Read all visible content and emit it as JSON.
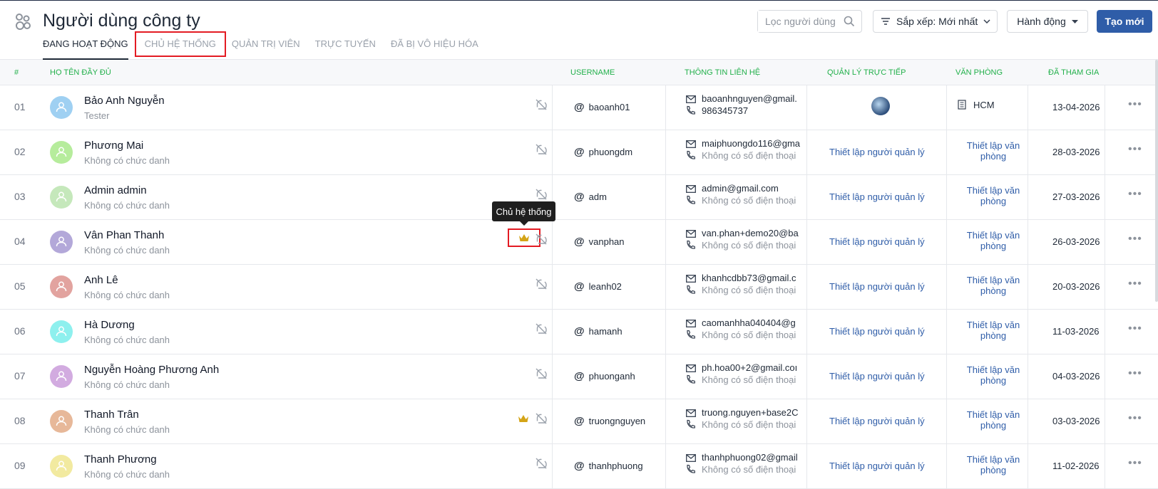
{
  "header": {
    "title": "Người dùng công ty",
    "tabs": [
      {
        "label": "ĐANG HOẠT ĐỘNG"
      },
      {
        "label": "CHỦ HỆ THỐNG"
      },
      {
        "label": "QUẢN TRỊ VIÊN"
      },
      {
        "label": "TRỰC TUYẾN"
      },
      {
        "label": "ĐÃ BỊ VÔ HIỆU HÓA"
      }
    ],
    "search_placeholder": "Lọc người dùng",
    "sort_label": "Sắp xếp: Mới nhất",
    "action_label": "Hành động",
    "new_label": "Tạo mới"
  },
  "table": {
    "columns": [
      "#",
      "HỌ TÊN ĐẦY ĐỦ",
      "USERNAME",
      "THÔNG TIN LIÊN HỆ",
      "QUẢN LÝ TRỰC TIẾP",
      "VĂN PHÒNG",
      "ĐÃ THAM GIA"
    ],
    "manager_link": "Thiết lập người quản lý",
    "office_link": "Thiết lập văn phòng",
    "rows": [
      {
        "num": "01",
        "name": "Bảo Anh Nguyễn",
        "role": "Tester",
        "username": "baoanh01",
        "email": "baoanhnguyen@gmail.",
        "phone": "986345737",
        "office": "HCM",
        "joined": "13-04-2026",
        "avatar_color": "#9fd0f2"
      },
      {
        "num": "02",
        "name": "Phương Mai",
        "role": "Không có chức danh",
        "username": "phuongdm",
        "email": "maiphuongdo116@gma",
        "phone": "Không có số điện thoại",
        "joined": "28-03-2026",
        "avatar_color": "#b6ec9c"
      },
      {
        "num": "03",
        "name": "Admin admin",
        "role": "Không có chức danh",
        "username": "adm",
        "email": "admin@gmail.com",
        "phone": "Không có số điện thoại",
        "joined": "27-03-2026",
        "avatar_color": "#c5e8bb"
      },
      {
        "num": "04",
        "name": "Vân Phan Thanh",
        "role": "Không có chức danh",
        "username": "vanphan",
        "email": "van.phan+demo20@ba",
        "phone": "Không có số điện thoại",
        "joined": "26-03-2026",
        "avatar_color": "#b3a8d9"
      },
      {
        "num": "05",
        "name": "Anh Lê",
        "role": "Không có chức danh",
        "username": "leanh02",
        "email": "khanhcdbb73@gmail.c",
        "phone": "Không có số điện thoại",
        "joined": "20-03-2026",
        "avatar_color": "#e2a39f"
      },
      {
        "num": "06",
        "name": "Hà Dương",
        "role": "Không có chức danh",
        "username": "hamanh",
        "email": "caomanhha040404@g",
        "phone": "Không có số điện thoại",
        "joined": "11-03-2026",
        "avatar_color": "#8ef0ee"
      },
      {
        "num": "07",
        "name": "Nguyễn Hoàng Phương Anh",
        "role": "Không có chức danh",
        "username": "phuonganh",
        "email": "ph.hoa00+2@gmail.coı",
        "phone": "Không có số điện thoại",
        "joined": "04-03-2026",
        "avatar_color": "#d2abe0"
      },
      {
        "num": "08",
        "name": "Thanh Trân",
        "role": "Không có chức danh",
        "username": "truongnguyen",
        "email": "truong.nguyen+base2C",
        "phone": "Không có số điện thoại",
        "joined": "03-03-2026",
        "avatar_color": "#e7b899"
      },
      {
        "num": "09",
        "name": "Thanh Phương",
        "role": "Không có chức danh",
        "username": "thanhphuong",
        "email": "thanhphuong02@gmail",
        "phone": "Không có số điện thoại",
        "joined": "11-02-2026",
        "avatar_color": "#f2eaa0"
      }
    ]
  },
  "tooltip": "Chủ hệ thống",
  "colors": {
    "accent": "#2f5da8",
    "header_green": "#22b04b",
    "highlight_red": "#e31b23",
    "crown": "#d4a417"
  }
}
